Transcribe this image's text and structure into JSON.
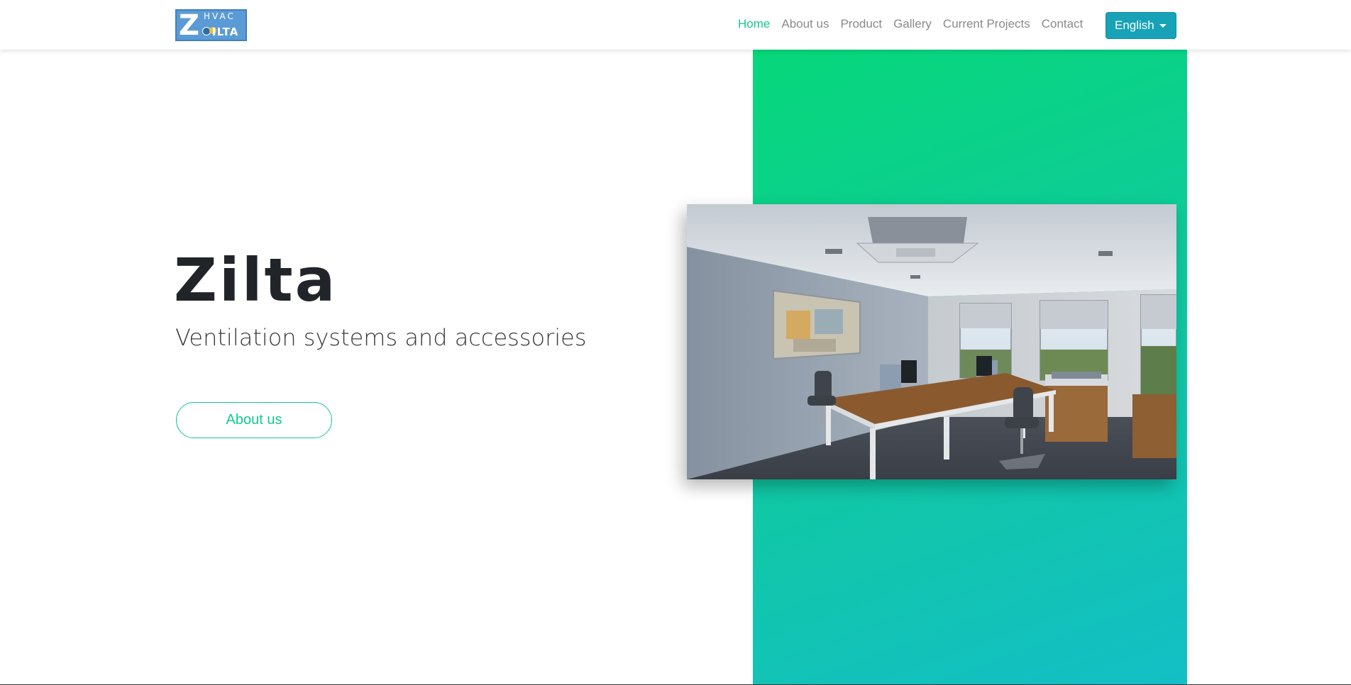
{
  "brand": {
    "logo_letter": "Z",
    "logo_top_text": "HVAC",
    "logo_bottom_text": "ILTA"
  },
  "nav": {
    "items": [
      {
        "label": "Home",
        "active": true
      },
      {
        "label": "About us",
        "active": false
      },
      {
        "label": "Product",
        "active": false
      },
      {
        "label": "Gallery",
        "active": false
      },
      {
        "label": "Current Projects",
        "active": false
      },
      {
        "label": "Contact",
        "active": false
      }
    ],
    "language_button": "English"
  },
  "hero": {
    "title": "Zilta",
    "subtitle": "Ventilation systems and accessories",
    "cta_label": "About us"
  },
  "colors": {
    "accent_green": "#13c98a",
    "language_button_bg": "#17a2b8",
    "gradient_top": "#07d77a",
    "gradient_bottom": "#13bfc6"
  }
}
